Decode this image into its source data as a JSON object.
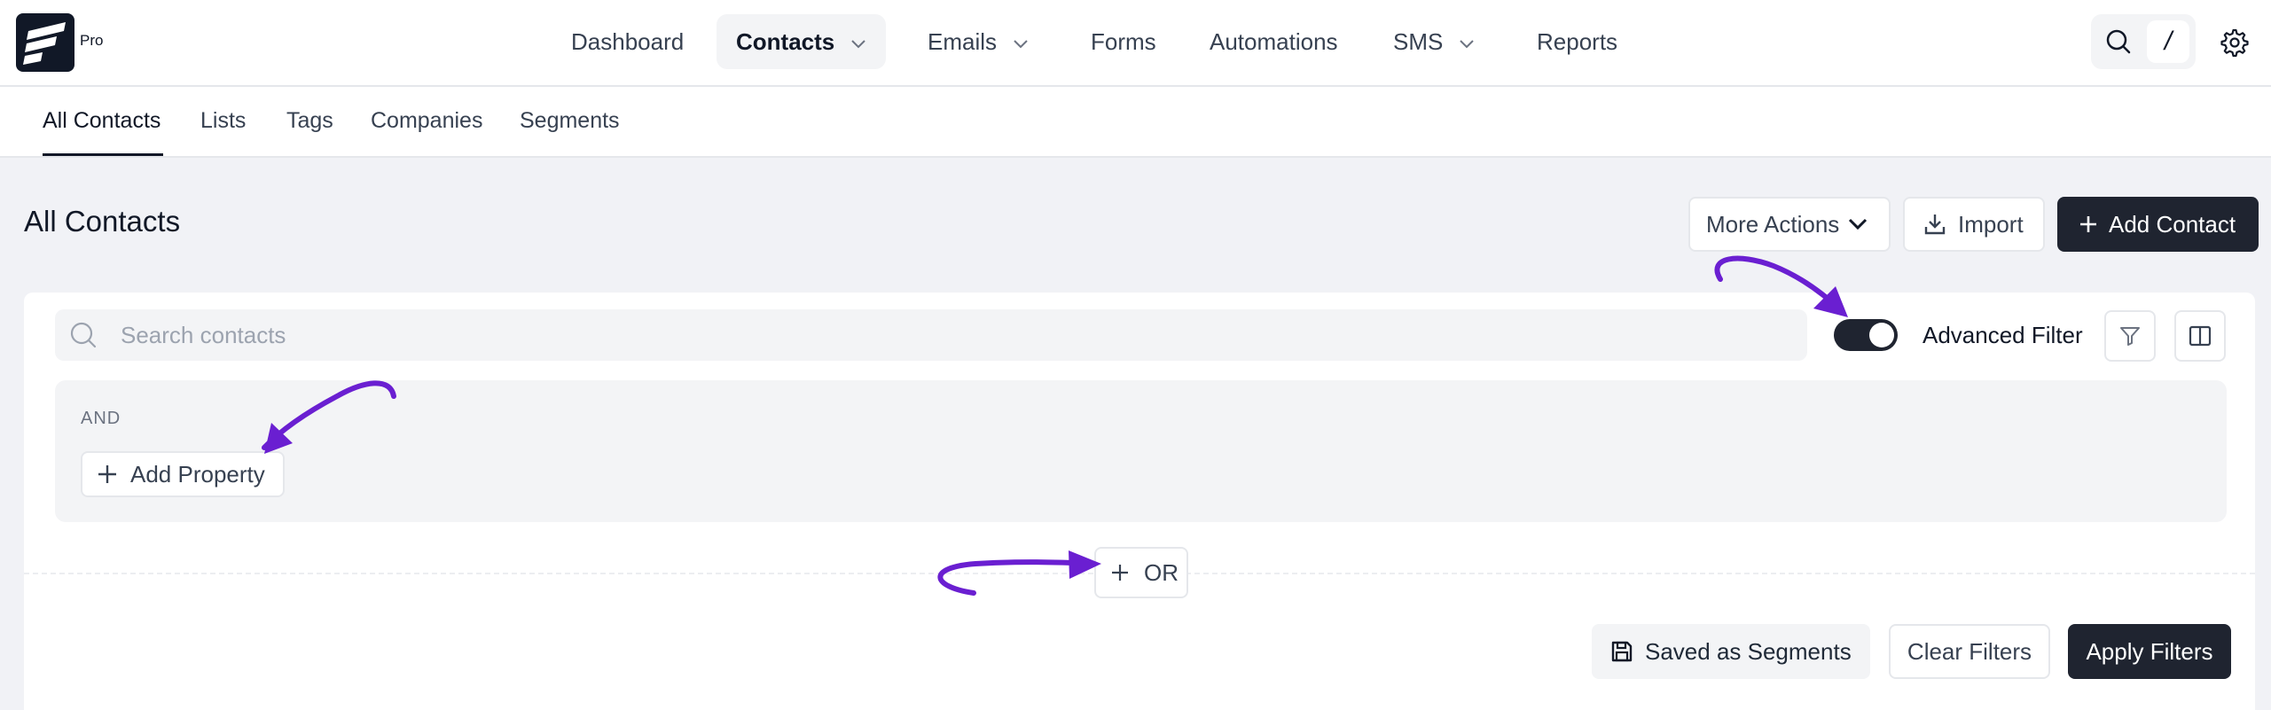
{
  "brand": {
    "badge": "Pro"
  },
  "nav": {
    "items": [
      {
        "label": "Dashboard",
        "has_dropdown": false,
        "active": false
      },
      {
        "label": "Contacts",
        "has_dropdown": true,
        "active": true
      },
      {
        "label": "Emails",
        "has_dropdown": true,
        "active": false
      },
      {
        "label": "Forms",
        "has_dropdown": false,
        "active": false
      },
      {
        "label": "Automations",
        "has_dropdown": false,
        "active": false
      },
      {
        "label": "SMS",
        "has_dropdown": true,
        "active": false
      },
      {
        "label": "Reports",
        "has_dropdown": false,
        "active": false
      }
    ],
    "search_shortcut": "/"
  },
  "subnav": {
    "tabs": [
      {
        "label": "All Contacts",
        "active": true
      },
      {
        "label": "Lists",
        "active": false
      },
      {
        "label": "Tags",
        "active": false
      },
      {
        "label": "Companies",
        "active": false
      },
      {
        "label": "Segments",
        "active": false
      }
    ]
  },
  "page": {
    "title": "All Contacts",
    "actions": {
      "more_actions": "More Actions",
      "import": "Import",
      "add_contact": "Add Contact"
    }
  },
  "filters": {
    "search_placeholder": "Search contacts",
    "search_value": "",
    "advanced_filter_label": "Advanced Filter",
    "advanced_filter_on": true,
    "group_operator": "AND",
    "add_property": "Add Property",
    "or_button": "OR",
    "saved_as_segments": "Saved as Segments",
    "clear_filters": "Clear Filters",
    "apply_filters": "Apply Filters"
  },
  "colors": {
    "accent_dark": "#1f2430",
    "annotation_arrow": "#6a1fd1",
    "page_bg": "#f1f2f6"
  }
}
